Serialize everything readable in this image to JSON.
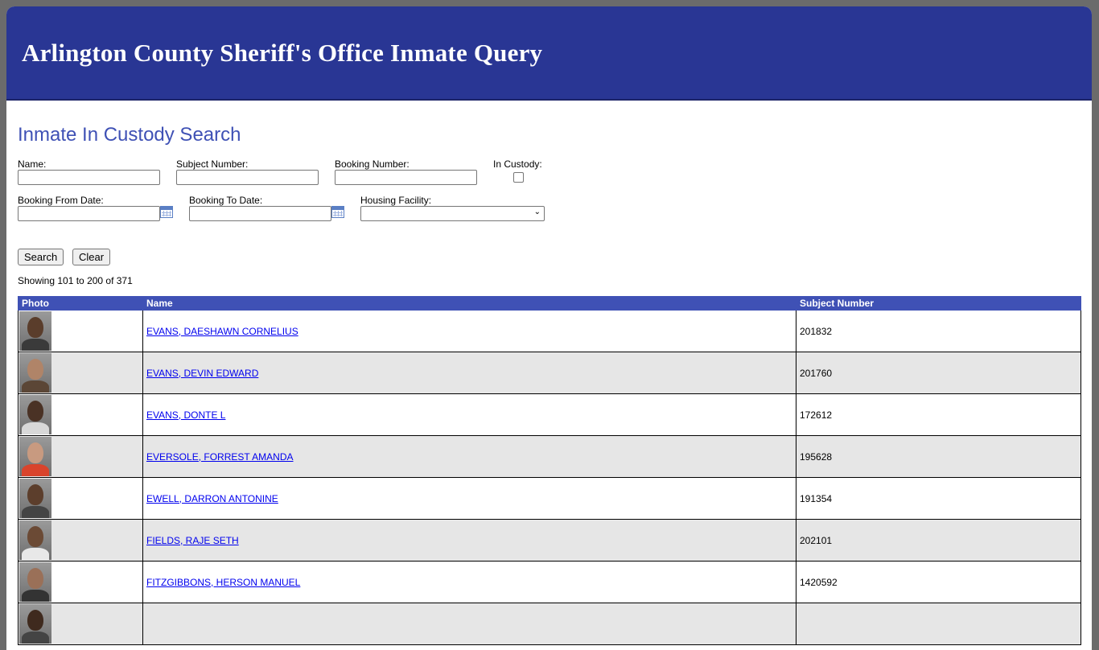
{
  "header": {
    "title": "Arlington County Sheriff's Office Inmate Query"
  },
  "search": {
    "title": "Inmate In Custody Search",
    "name_label": "Name:",
    "name_value": "",
    "subject_label": "Subject Number:",
    "subject_value": "",
    "booking_label": "Booking Number:",
    "booking_value": "",
    "in_custody_label": "In Custody:",
    "in_custody_checked": false,
    "from_date_label": "Booking From Date:",
    "from_date_value": "",
    "to_date_label": "Booking To Date:",
    "to_date_value": "",
    "housing_label": "Housing Facility:",
    "housing_value": "",
    "search_button": "Search",
    "clear_button": "Clear"
  },
  "results": {
    "showing": "Showing 101 to 200 of 371",
    "columns": [
      "Photo",
      "Name",
      "Subject Number"
    ],
    "rows": [
      {
        "name": "EVANS, DAESHAWN CORNELIUS",
        "subject": "201832",
        "skin": "#5a3d2b",
        "shirt": "#3a3a3a"
      },
      {
        "name": "EVANS, DEVIN EDWARD",
        "subject": "201760",
        "skin": "#b08468",
        "shirt": "#5b4636"
      },
      {
        "name": "EVANS, DONTE L",
        "subject": "172612",
        "skin": "#4a3225",
        "shirt": "#d8d8d8"
      },
      {
        "name": "EVERSOLE, FORREST AMANDA",
        "subject": "195628",
        "skin": "#c89a80",
        "shirt": "#d9442c"
      },
      {
        "name": "EWELL, DARRON ANTONINE",
        "subject": "191354",
        "skin": "#5c3e2c",
        "shirt": "#444444"
      },
      {
        "name": "FIELDS, RAJE SETH",
        "subject": "202101",
        "skin": "#6b4a35",
        "shirt": "#e8e8e8"
      },
      {
        "name": "FITZGIBBONS, HERSON MANUEL",
        "subject": "1420592",
        "skin": "#9a7058",
        "shirt": "#333333"
      },
      {
        "name": "",
        "subject": "",
        "skin": "#3f2a1e",
        "shirt": "#444444"
      }
    ]
  }
}
